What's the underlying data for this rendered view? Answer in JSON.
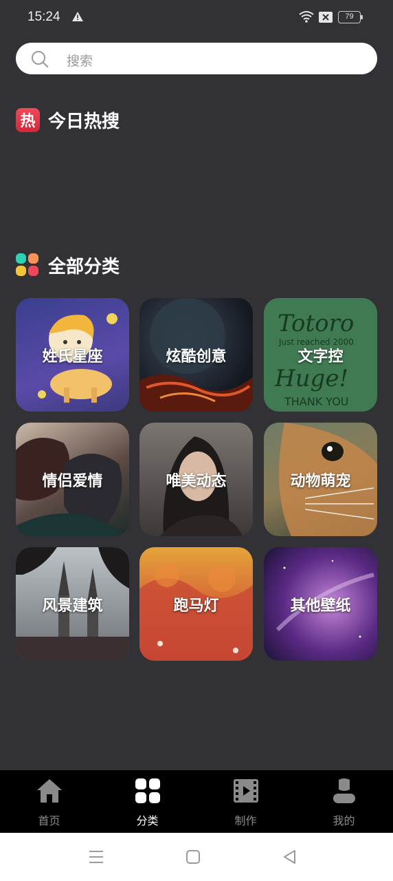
{
  "status": {
    "time": "15:24",
    "battery": "79"
  },
  "search": {
    "placeholder": "搜索"
  },
  "sections": {
    "hot": {
      "icon_char": "热",
      "title": "今日热搜"
    },
    "all": {
      "title": "全部分类"
    }
  },
  "categories": [
    {
      "label": "姓氏星座"
    },
    {
      "label": "炫酷创意"
    },
    {
      "label": "文字控"
    },
    {
      "label": "情侣爱情"
    },
    {
      "label": "唯美动态"
    },
    {
      "label": "动物萌宠"
    },
    {
      "label": "风景建筑"
    },
    {
      "label": "跑马灯"
    },
    {
      "label": "其他壁纸"
    }
  ],
  "card_thumbnail_text": {
    "line1": "Totoro",
    "line2": "Just reached 2000",
    "line3": "Huge!",
    "line4": "THANK YOU"
  },
  "nav": {
    "items": [
      {
        "label": "首页"
      },
      {
        "label": "分类"
      },
      {
        "label": "制作"
      },
      {
        "label": "我的"
      }
    ],
    "active_index": 1
  },
  "colors": {
    "background": "#323136",
    "accent_hot": "#e8344a",
    "grid_teal": "#2ad3b4",
    "grid_orange": "#f7935a",
    "grid_yellow": "#f8c437",
    "grid_red": "#f0465a"
  }
}
